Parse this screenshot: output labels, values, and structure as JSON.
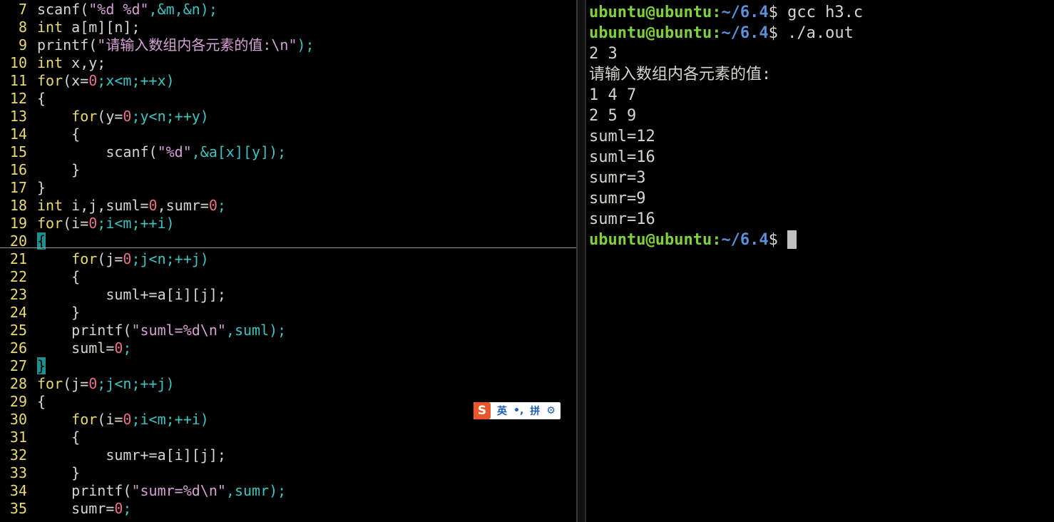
{
  "editor": {
    "lines": [
      {
        "n": "7",
        "tokens": [
          {
            "t": "scanf(",
            "c": "id"
          },
          {
            "t": "\"%d %d\"",
            "c": "str"
          },
          {
            "t": ",&m,&n);",
            "c": "op"
          }
        ]
      },
      {
        "n": "8",
        "tokens": [
          {
            "t": "int",
            "c": "kw"
          },
          {
            "t": " a[m][n];",
            "c": "id"
          }
        ]
      },
      {
        "n": "9",
        "tokens": [
          {
            "t": "printf(",
            "c": "id"
          },
          {
            "t": "\"请输入数组内各元素的值:\\n\"",
            "c": "str"
          },
          {
            "t": ");",
            "c": "op"
          }
        ]
      },
      {
        "n": "10",
        "tokens": [
          {
            "t": "int",
            "c": "kw"
          },
          {
            "t": " x,y;",
            "c": "id"
          }
        ]
      },
      {
        "n": "11",
        "tokens": [
          {
            "t": "for",
            "c": "kw"
          },
          {
            "t": "(x=",
            "c": "id"
          },
          {
            "t": "0",
            "c": "num"
          },
          {
            "t": ";x<m;++x)",
            "c": "op"
          }
        ]
      },
      {
        "n": "12",
        "tokens": [
          {
            "t": "{",
            "c": "id"
          }
        ]
      },
      {
        "n": "13",
        "tokens": [
          {
            "t": "    for",
            "c": "kw"
          },
          {
            "t": "(y=",
            "c": "id"
          },
          {
            "t": "0",
            "c": "num"
          },
          {
            "t": ";y<n;++y)",
            "c": "op"
          }
        ]
      },
      {
        "n": "14",
        "tokens": [
          {
            "t": "    {",
            "c": "id"
          }
        ]
      },
      {
        "n": "15",
        "tokens": [
          {
            "t": "        scanf(",
            "c": "id"
          },
          {
            "t": "\"%d\"",
            "c": "str"
          },
          {
            "t": ",&a[x][y]);",
            "c": "op"
          }
        ]
      },
      {
        "n": "16",
        "tokens": [
          {
            "t": "    }",
            "c": "id"
          }
        ]
      },
      {
        "n": "17",
        "tokens": [
          {
            "t": "}",
            "c": "id"
          }
        ]
      },
      {
        "n": "18",
        "tokens": [
          {
            "t": "int",
            "c": "kw"
          },
          {
            "t": " i,j,suml=",
            "c": "id"
          },
          {
            "t": "0",
            "c": "num"
          },
          {
            "t": ",sumr=",
            "c": "id"
          },
          {
            "t": "0",
            "c": "num"
          },
          {
            "t": ";",
            "c": "op"
          }
        ]
      },
      {
        "n": "19",
        "tokens": [
          {
            "t": "for",
            "c": "kw"
          },
          {
            "t": "(i=",
            "c": "id"
          },
          {
            "t": "0",
            "c": "num"
          },
          {
            "t": ";i<m;++i)",
            "c": "op"
          }
        ]
      },
      {
        "n": "20",
        "tokens": [
          {
            "t": "{",
            "c": "hlb"
          }
        ]
      },
      {
        "n": "21",
        "tokens": [
          {
            "t": "    for",
            "c": "kw"
          },
          {
            "t": "(j=",
            "c": "id"
          },
          {
            "t": "0",
            "c": "num"
          },
          {
            "t": ";j<n;++j)",
            "c": "op"
          }
        ]
      },
      {
        "n": "22",
        "tokens": [
          {
            "t": "    {",
            "c": "id"
          }
        ]
      },
      {
        "n": "23",
        "tokens": [
          {
            "t": "        suml+=a[i][j];",
            "c": "id"
          }
        ]
      },
      {
        "n": "24",
        "tokens": [
          {
            "t": "    }",
            "c": "id"
          }
        ]
      },
      {
        "n": "25",
        "tokens": [
          {
            "t": "    printf(",
            "c": "id"
          },
          {
            "t": "\"suml=%d\\n\"",
            "c": "str"
          },
          {
            "t": ",suml);",
            "c": "op"
          }
        ]
      },
      {
        "n": "26",
        "tokens": [
          {
            "t": "    suml=",
            "c": "id"
          },
          {
            "t": "0",
            "c": "num"
          },
          {
            "t": ";",
            "c": "op"
          }
        ]
      },
      {
        "n": "27",
        "tokens": [
          {
            "t": "}",
            "c": "hl"
          }
        ]
      },
      {
        "n": "28",
        "tokens": [
          {
            "t": "for",
            "c": "kw"
          },
          {
            "t": "(j=",
            "c": "id"
          },
          {
            "t": "0",
            "c": "num"
          },
          {
            "t": ";j<n;++j)",
            "c": "op"
          }
        ]
      },
      {
        "n": "29",
        "tokens": [
          {
            "t": "{",
            "c": "id"
          }
        ]
      },
      {
        "n": "30",
        "tokens": [
          {
            "t": "    for",
            "c": "kw"
          },
          {
            "t": "(i=",
            "c": "id"
          },
          {
            "t": "0",
            "c": "num"
          },
          {
            "t": ";i<m;++i)",
            "c": "op"
          }
        ]
      },
      {
        "n": "31",
        "tokens": [
          {
            "t": "    {",
            "c": "id"
          }
        ]
      },
      {
        "n": "32",
        "tokens": [
          {
            "t": "        sumr+=a[i][j];",
            "c": "id"
          }
        ]
      },
      {
        "n": "33",
        "tokens": [
          {
            "t": "    }",
            "c": "id"
          }
        ]
      },
      {
        "n": "34",
        "tokens": [
          {
            "t": "    printf(",
            "c": "id"
          },
          {
            "t": "\"sumr=%d\\n\"",
            "c": "str"
          },
          {
            "t": ",sumr);",
            "c": "op"
          }
        ]
      },
      {
        "n": "35",
        "tokens": [
          {
            "t": "    sumr=",
            "c": "id"
          },
          {
            "t": "0",
            "c": "num"
          },
          {
            "t": ";",
            "c": "op"
          }
        ]
      }
    ]
  },
  "terminal": {
    "prompt_user": "ubuntu@ubuntu",
    "prompt_sep": ":",
    "prompt_path": "~/6.4",
    "prompt_end": "$",
    "lines": [
      {
        "type": "cmd",
        "text": " gcc h3.c"
      },
      {
        "type": "cmd",
        "text": " ./a.out"
      },
      {
        "type": "out",
        "text": "2 3"
      },
      {
        "type": "out",
        "text": "请输入数组内各元素的值:"
      },
      {
        "type": "out",
        "text": "1 4 7"
      },
      {
        "type": "out",
        "text": "2 5 9"
      },
      {
        "type": "out",
        "text": "suml=12"
      },
      {
        "type": "out",
        "text": "suml=16"
      },
      {
        "type": "out",
        "text": "sumr=3"
      },
      {
        "type": "out",
        "text": "sumr=9"
      },
      {
        "type": "out",
        "text": "sumr=16"
      },
      {
        "type": "prompt",
        "text": " "
      }
    ]
  },
  "ime": {
    "logo": "S",
    "mode": "英",
    "punct": "•,",
    "input": "拼",
    "settings_icon": "gear-icon"
  }
}
